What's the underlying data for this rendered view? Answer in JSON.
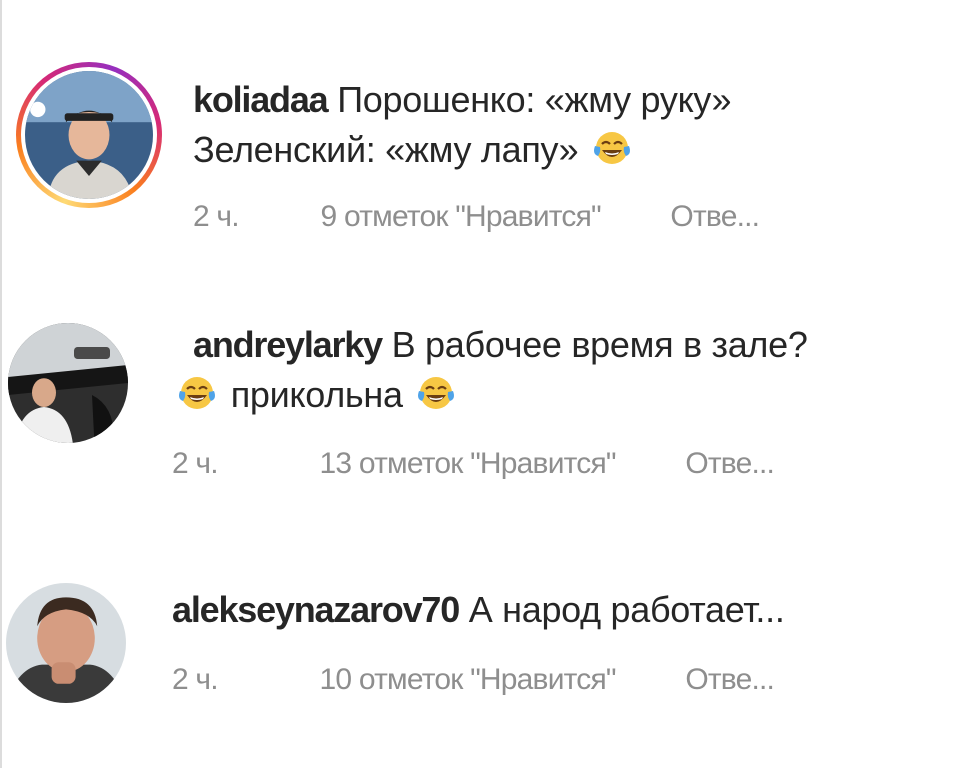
{
  "comments": [
    {
      "username": "koliadaa",
      "line1": "Порошенко: «жму руку»",
      "line2": "Зеленский: «жму лапу»",
      "time": "2 ч.",
      "likes": "9 отметок \"Нравится\"",
      "reply": "Отве..."
    },
    {
      "username": "andreylarky",
      "line1": "В рабочее время в зале?",
      "line2": "прикольна",
      "time": "2 ч.",
      "likes": "13 отметок \"Нравится\"",
      "reply": "Отве..."
    },
    {
      "username": "alekseynazarov70",
      "line1": "А народ работает...",
      "time": "2 ч.",
      "likes": "10 отметок \"Нравится\"",
      "reply": "Отве..."
    }
  ],
  "icons": {
    "emoji": "face-with-tears-of-joy-icon"
  },
  "colors": {
    "text": "#262626",
    "meta": "#8e8e8e",
    "story_ring": "#d62976",
    "emoji_face": "#f7c744",
    "emoji_tears": "#4fa3e8"
  }
}
